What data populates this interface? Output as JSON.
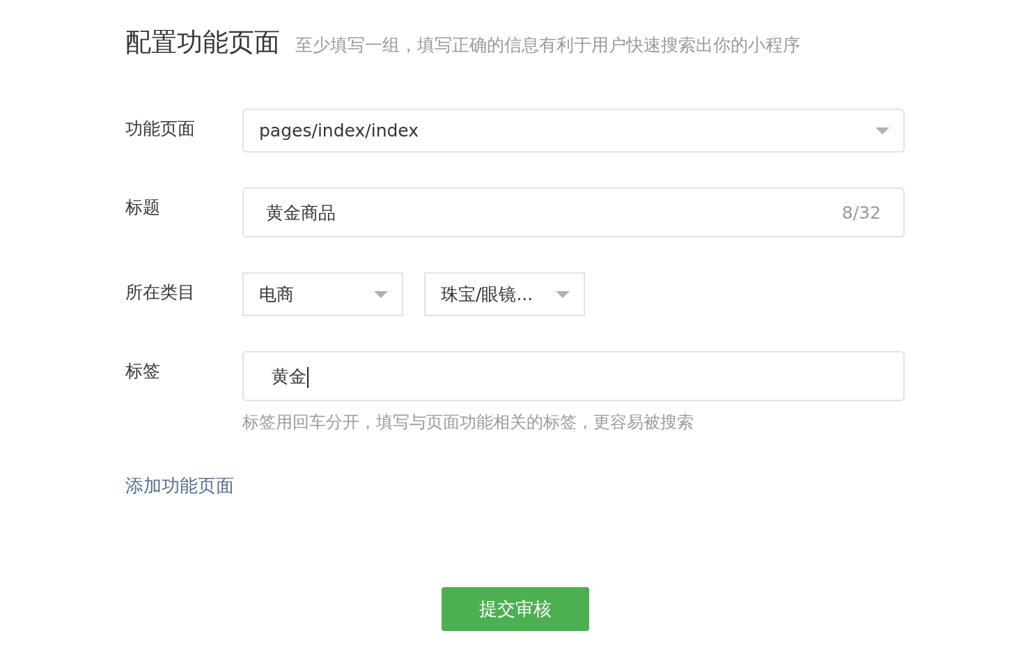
{
  "header": {
    "title": "配置功能页面",
    "subtitle": "至少填写一组，填写正确的信息有利于用户快速搜索出你的小程序"
  },
  "fields": [
    {
      "kind": "select",
      "label": "功能页面",
      "value": "pages/index/index"
    },
    {
      "kind": "text",
      "label": "标题",
      "value": "黄金商品",
      "counter": "8/32"
    },
    {
      "kind": "selects",
      "label": "所在类目",
      "options": [
        "电商",
        "珠宝/眼镜..."
      ]
    },
    {
      "kind": "tags",
      "label": "标签",
      "value": "黄金",
      "focused": true,
      "hint": "标签用回车分开，填写与页面功能相关的标签，更容易被搜索"
    }
  ],
  "add_link": "添加功能页面",
  "submit": "提交审核"
}
